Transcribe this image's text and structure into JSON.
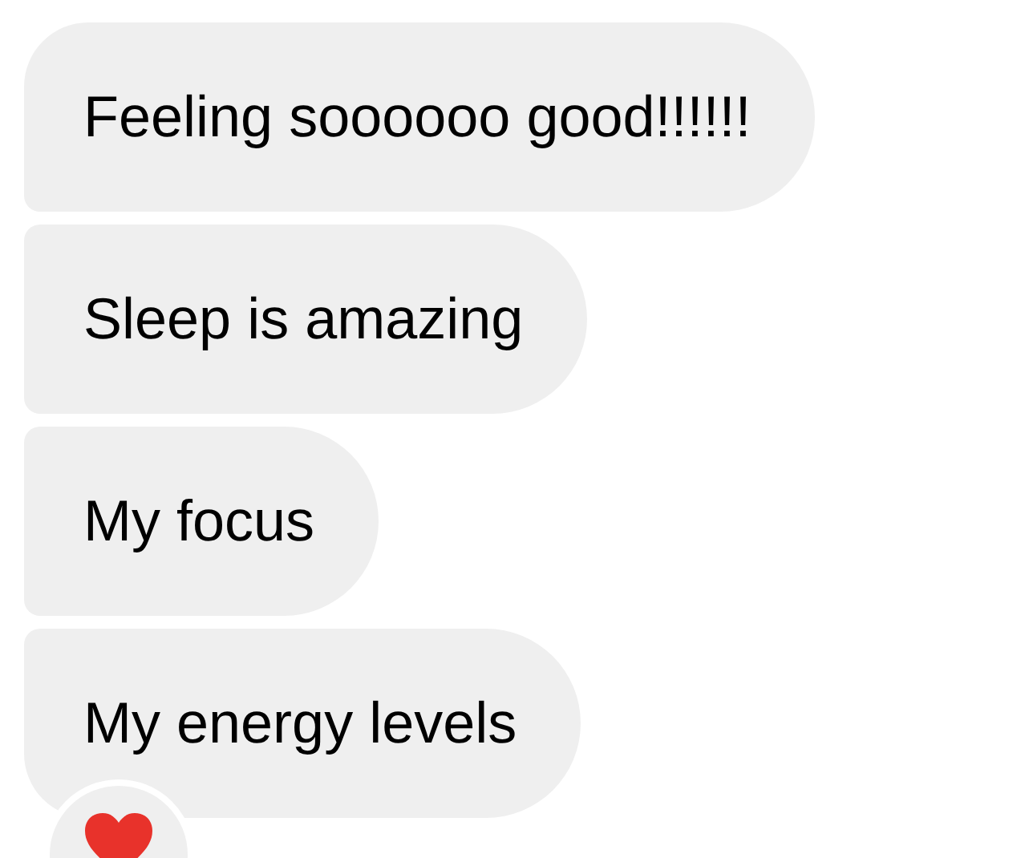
{
  "messages": [
    {
      "text": "Feeling soooooo good!!!!!!"
    },
    {
      "text": "Sleep is amazing"
    },
    {
      "text": "My focus"
    },
    {
      "text": "My energy levels"
    }
  ],
  "reaction": {
    "kind": "heart"
  }
}
